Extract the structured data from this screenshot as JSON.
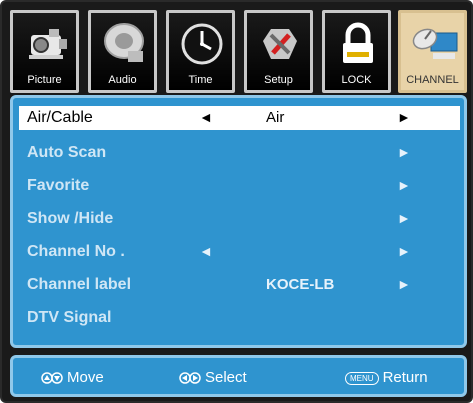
{
  "tabs": [
    {
      "label": "Picture",
      "icon": "camera-icon"
    },
    {
      "label": "Audio",
      "icon": "audio-icon"
    },
    {
      "label": "Time",
      "icon": "clock-icon"
    },
    {
      "label": "Setup",
      "icon": "setup-icon"
    },
    {
      "label": "LOCK",
      "icon": "lock-icon"
    },
    {
      "label": "CHANNEL",
      "icon": "satellite-icon",
      "active": true
    }
  ],
  "menu": {
    "rows": [
      {
        "label": "Air/Cable",
        "value": "Air",
        "left_arrow": "◄",
        "right_arrow": "►",
        "selected": true
      },
      {
        "label": "Auto Scan",
        "value": "",
        "left_arrow": "",
        "right_arrow": "►"
      },
      {
        "label": "Favorite",
        "value": "",
        "left_arrow": "",
        "right_arrow": "►"
      },
      {
        "label": "Show /Hide",
        "value": "",
        "left_arrow": "",
        "right_arrow": "►"
      },
      {
        "label": "Channel No .",
        "value": "",
        "left_arrow": "◄",
        "right_arrow": "►"
      },
      {
        "label": "Channel label",
        "value": "KOCE-LB",
        "left_arrow": "",
        "right_arrow": "►"
      },
      {
        "label": "DTV Signal",
        "value": "",
        "left_arrow": "",
        "right_arrow": ""
      }
    ]
  },
  "footer": {
    "move_label": "Move",
    "select_label": "Select",
    "menu_badge": "MENU",
    "return_label": "Return"
  },
  "colors": {
    "panel_bg": "#2f94cf",
    "panel_border": "#8fc8ea",
    "active_tab_bg": "#e8d3a8",
    "selected_row_bg": "#ffffff"
  }
}
